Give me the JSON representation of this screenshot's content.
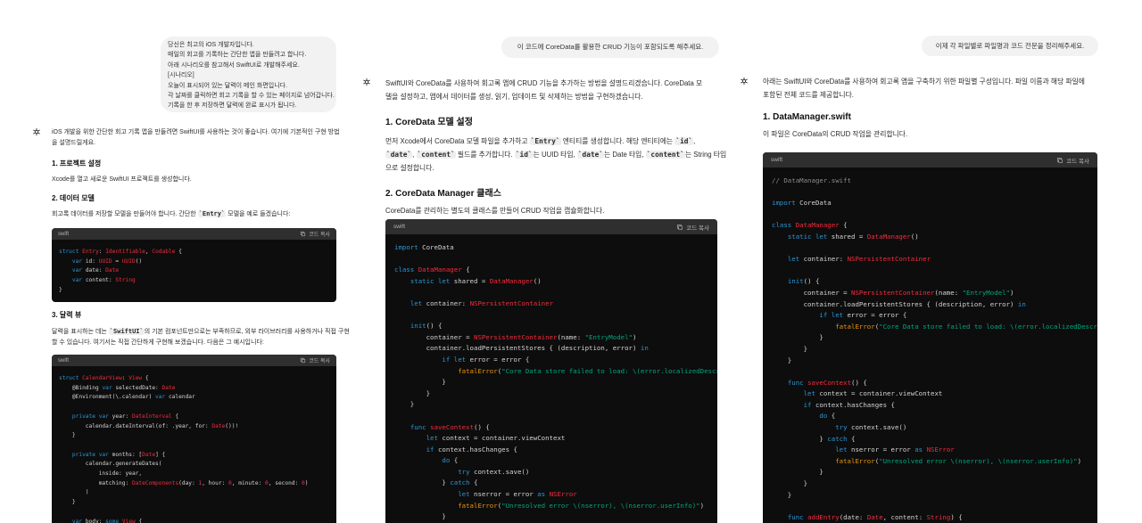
{
  "col1": {
    "user_message_lines": [
      "당신은 최고의 iOS 개발자입니다.",
      "매일의 회고를 기록하는 간단한 앱을 만들려고 합니다.",
      "아래 시나리오를 참고해서 SwiftUI로 개발해주세요.",
      "[시나리오]",
      "오늘이 표시되어 있는 달력이 메인 화면입니다.",
      "각 날짜를 클릭하면 회고 기록을 할 수 있는 페이지로 넘어갑니다.",
      "기록을 한 후 저장하면 달력에 완료 표시가 됩니다."
    ],
    "intro_1": "iOS 개발을 위한 간단한 회고 기록 앱을 만들려면 SwiftUI를 사용하는 것이 좋습니다. 여기에 기본적인 구현 방법",
    "intro_2": "을 설명드릴게요.",
    "h1": "1. 프로젝트 설정",
    "p1": "Xcode를 열고 새로운 SwiftUI 프로젝트를 생성합니다.",
    "h2": "2. 데이터 모델",
    "p2_a": "회고록 데이터를 저장할 모델을 만들어야 합니다. 간단한 ",
    "p2_code": "`Entry`",
    "p2_b": " 모델을 예로 들겠습니다:",
    "code1_lang": "swift",
    "code1_copy": "코드 복사",
    "h3": "3. 달력 뷰",
    "p3_a": "달력을 표시하는 데는 ",
    "p3_code": "`SwiftUI`",
    "p3_b": "의 기본 컴포넌트만으로는 부족하므로, 외부 라이브러리를 사용하거나 직접 구현",
    "p3_c": "할 수 있습니다. 여기서는 직접 간단하게 구현해 보겠습니다. 다음은 그 예시입니다:",
    "code2_lang": "swift",
    "code2_copy": "코드 복사"
  },
  "col2": {
    "user_message": "이 코드에 CoreData를 활용한 CRUD 기능이 포함되도록 해주세요.",
    "intro_1": "SwiftUI와 CoreData를 사용하여 회고록 앱에 CRUD 기능을 추가하는 방법을 설명드리겠습니다. CoreData 모",
    "intro_2": "델을 설정하고, 앱에서 데이터를 생성, 읽기, 업데이트 및 삭제하는 방법을 구현하겠습니다.",
    "h1": "1. CoreData 모델 설정",
    "p1_a": "먼저 Xcode에서 CoreData 모델 파일을 추가하고 ",
    "p1_code1": "`Entry`",
    "p1_b": " 엔티티를 생성합니다. 해당 엔티티에는 ",
    "p1_code2": "`id`",
    "p1_c": ",",
    "p1_code3": "`date`",
    "p1_d": ", ",
    "p1_code4": "`content`",
    "p1_e": " 필드를 추가합니다. ",
    "p1_code5": "`id`",
    "p1_f": "는 UUID 타입, ",
    "p1_code6": "`date`",
    "p1_g": "는 Date 타입, ",
    "p1_code7": "`content`",
    "p1_h": "는 String 타입",
    "p1_i": "으로 설정합니다.",
    "h2": "2. CoreData Manager 클래스",
    "p2": "CoreData를 관리하는 별도의 클래스를 만들어 CRUD 작업을 캡슐화합니다.",
    "code_lang": "swift",
    "code_copy": "코드 복사"
  },
  "col3": {
    "user_message": "이제 각 파일별로 파일명과 코드 전문을 정리해주세요.",
    "intro_1": "아래는 SwiftUI와 CoreData를 사용하여 회고록 앱을 구축하기 위한 파일별 구성입니다. 파일 이름과 해당 파일에",
    "intro_2": "포함된 전체 코드를 제공합니다.",
    "h1": "1. DataManager.swift",
    "p1": "이 파일은 CoreData의 CRUD 작업을 관리합니다.",
    "code_lang": "swift",
    "code_copy": "코드 복사"
  },
  "colors": {
    "code_bg": "#0d0d0d",
    "code_header": "#2f2f2f",
    "keyword": "#2e95d3",
    "type": "#f22c3d",
    "string": "#00a67d",
    "number": "#df3079",
    "bubble": "#f2f2f2"
  },
  "icons": [
    "chatgpt-logo-icon",
    "copy-icon"
  ]
}
